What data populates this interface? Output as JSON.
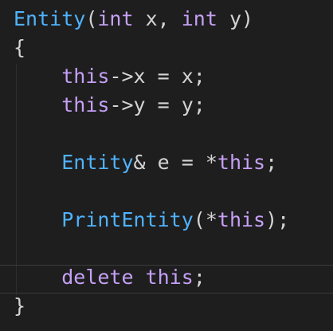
{
  "editor": {
    "lines": [
      [
        {
          "t": "Entity",
          "c": "class"
        },
        {
          "t": "(",
          "c": "plain"
        },
        {
          "t": "int",
          "c": "kw2"
        },
        {
          "t": " x, ",
          "c": "plain"
        },
        {
          "t": "int",
          "c": "kw2"
        },
        {
          "t": " y)",
          "c": "plain"
        }
      ],
      [
        {
          "t": "{",
          "c": "plain"
        }
      ],
      [
        {
          "t": "    ",
          "c": "plain"
        },
        {
          "t": "this",
          "c": "kw2"
        },
        {
          "t": "->x = x;",
          "c": "plain"
        }
      ],
      [
        {
          "t": "    ",
          "c": "plain"
        },
        {
          "t": "this",
          "c": "kw2"
        },
        {
          "t": "->y = y;",
          "c": "plain"
        }
      ],
      [],
      [
        {
          "t": "    ",
          "c": "plain"
        },
        {
          "t": "Entity",
          "c": "class"
        },
        {
          "t": "& e = *",
          "c": "plain"
        },
        {
          "t": "this",
          "c": "kw2"
        },
        {
          "t": ";",
          "c": "plain"
        }
      ],
      [],
      [
        {
          "t": "    ",
          "c": "plain"
        },
        {
          "t": "PrintEntity",
          "c": "class"
        },
        {
          "t": "(*",
          "c": "plain"
        },
        {
          "t": "this",
          "c": "kw2"
        },
        {
          "t": ");",
          "c": "plain"
        }
      ],
      [],
      [
        {
          "t": "    ",
          "c": "plain"
        },
        {
          "t": "delete",
          "c": "kw2"
        },
        {
          "t": " ",
          "c": "plain"
        },
        {
          "t": "this",
          "c": "kw2"
        },
        {
          "t": ";",
          "c": "plain"
        }
      ],
      [
        {
          "t": "}",
          "c": "plain"
        }
      ]
    ],
    "colors": {
      "background": "#1e1e1e",
      "class": "#4fb3ff",
      "keyword": "#c6a0f6",
      "plain": "#d4d4d4"
    }
  }
}
